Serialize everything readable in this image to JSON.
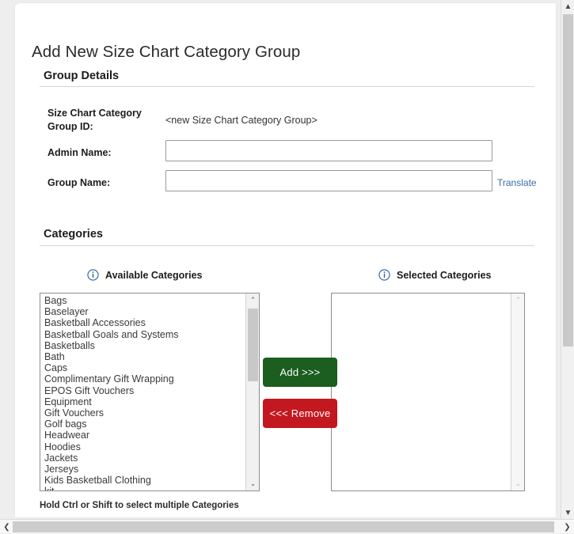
{
  "page": {
    "title": "Add New Size Chart Category Group"
  },
  "sections": {
    "group_details": {
      "heading": "Group Details",
      "fields": {
        "group_id_label": "Size Chart Category Group ID:",
        "group_id_value": "<new Size Chart Category Group>",
        "admin_name_label": "Admin Name:",
        "admin_name_value": "",
        "admin_name_placeholder": "",
        "group_name_label": "Group Name:",
        "group_name_value": "",
        "group_name_placeholder": "",
        "translate_link": "Translate"
      }
    },
    "categories": {
      "heading": "Categories",
      "available_caption": "Available Categories",
      "selected_caption": "Selected Categories",
      "available_items": [
        "Bags",
        "Baselayer",
        "Basketball Accessories",
        "Basketball Goals and Systems",
        "Basketballs",
        "Bath",
        "Caps",
        "Complimentary Gift Wrapping",
        "EPOS Gift Vouchers",
        "Equipment",
        "Gift Vouchers",
        "Golf bags",
        "Headwear",
        "Hoodies",
        "Jackets",
        "Jerseys",
        "Kids Basketball Clothing",
        "kit"
      ],
      "selected_items": [],
      "add_button": "Add >>>",
      "remove_button": "<<< Remove",
      "hint": "Hold Ctrl or Shift to select multiple Categories"
    }
  },
  "icons": {
    "info": "info-circle-icon",
    "scroll_up": "▲",
    "scroll_down": "▼",
    "scroll_left": "❮",
    "scroll_right": "❯",
    "list_up": "⌃",
    "list_down": "⌄"
  },
  "colors": {
    "add_button": "#1b5e20",
    "remove_button": "#c3181f",
    "link": "#3a6ea5",
    "info_icon": "#2c5f9e",
    "page_background": "#eeeeee",
    "card_background": "#ffffff"
  }
}
